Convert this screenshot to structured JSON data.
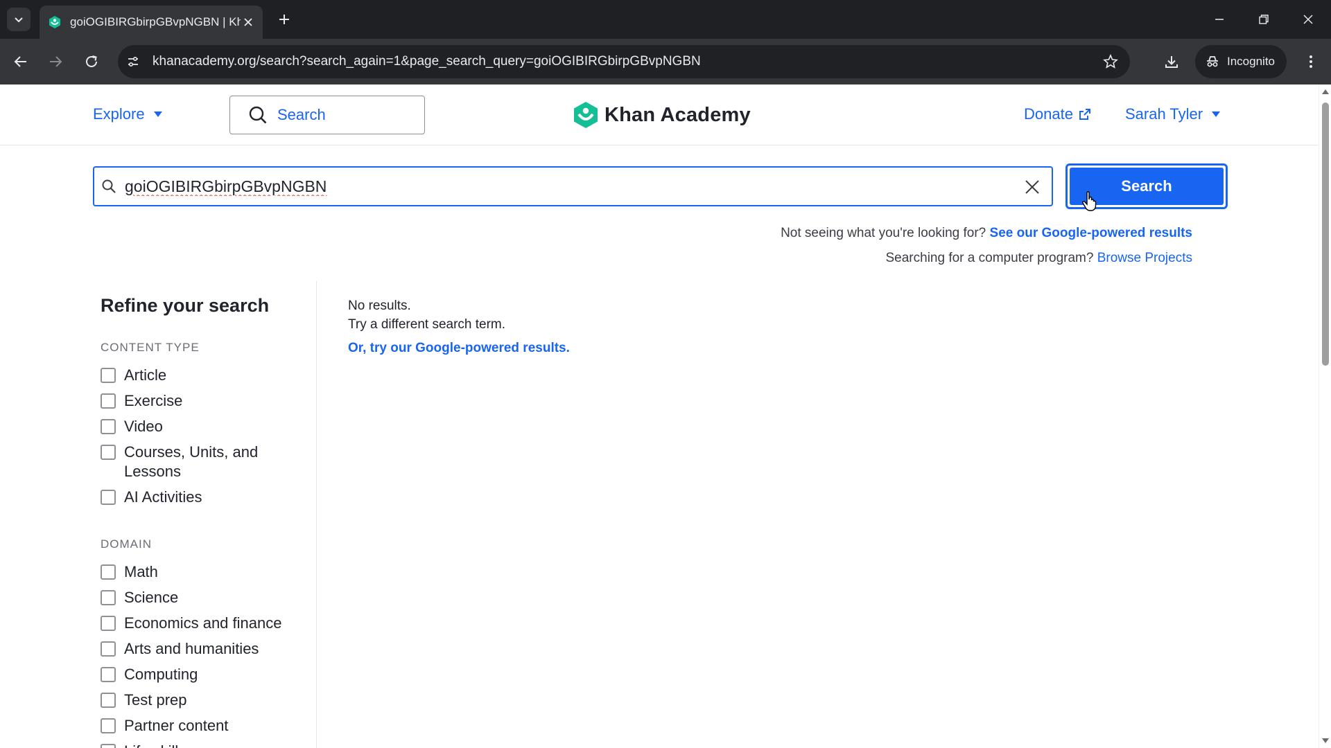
{
  "browser": {
    "tab_title": "goiOGIBIRGbirpGBvpNGBN | Kh",
    "url": "khanacademy.org/search?search_again=1&page_search_query=goiOGIBIRGbirpGBvpNGBN",
    "incognito_label": "Incognito",
    "accent": "#35363a"
  },
  "header": {
    "explore_label": "Explore",
    "search_label": "Search",
    "logo_text": "Khan Academy",
    "donate_label": "Donate",
    "user_name": "Sarah Tyler"
  },
  "search": {
    "query": "goiOGIBIRGbirpGBvpNGBN",
    "button_label": "Search",
    "help_prompt": "Not seeing what you're looking for?",
    "help_link": "See our Google-powered results",
    "program_prompt": "Searching for a computer program?",
    "program_link": "Browse Projects"
  },
  "sidebar": {
    "title": "Refine your search",
    "content_type_heading": "CONTENT TYPE",
    "content_types": [
      "Article",
      "Exercise",
      "Video",
      "Courses, Units, and Lessons",
      "AI Activities"
    ],
    "domain_heading": "DOMAIN",
    "domains": [
      "Math",
      "Science",
      "Economics and finance",
      "Arts and humanities",
      "Computing",
      "Test prep",
      "Partner content",
      "Life skills"
    ]
  },
  "results": {
    "no_results": "No results.",
    "try_different": "Try a different search term.",
    "google_link": "Or, try our Google-powered results."
  },
  "colors": {
    "brand_blue": "#1865f2",
    "logo_green": "#14bf96",
    "text": "#21242c"
  }
}
